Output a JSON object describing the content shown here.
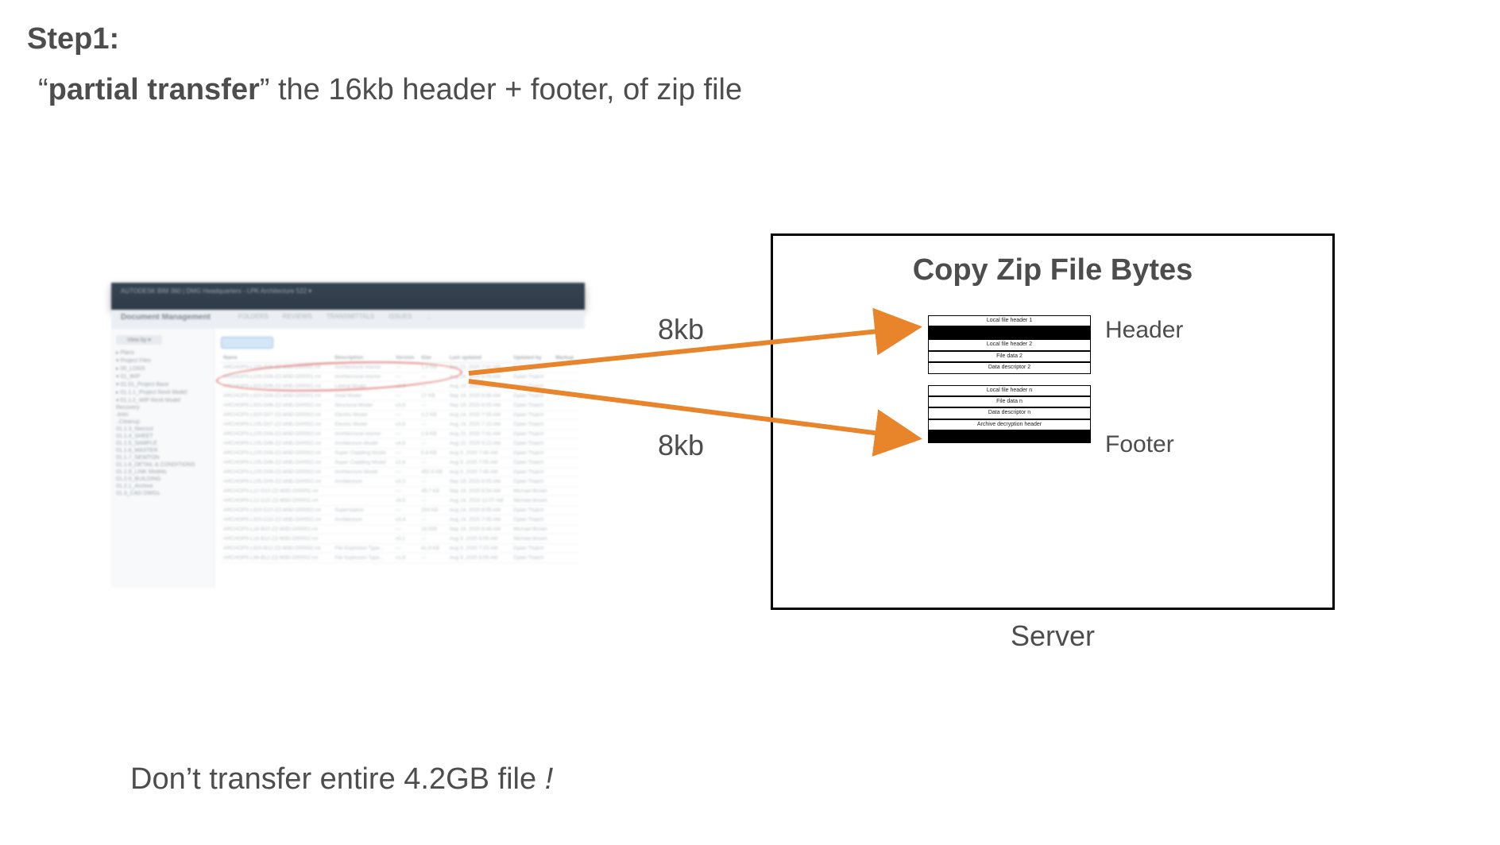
{
  "step": {
    "label": "Step1:",
    "quote_open": "“",
    "bold_phrase": "partial transfer",
    "quote_close": "”",
    "rest": " the 16kb header + footer, of zip file"
  },
  "arrows": {
    "top_label": "8kb",
    "bottom_label": "8kb"
  },
  "server": {
    "title": "Copy Zip File Bytes",
    "caption": "Server",
    "header_label": "Header",
    "footer_label": "Footer",
    "zip_rows": {
      "r1": "Local file header 1",
      "r3": "Local file header 2",
      "r4": "File data 2",
      "r5": "Data descriptor 2",
      "r6": "Local file header n",
      "r7": "File data n",
      "r8": "Data descriptor n",
      "r9": "Archive decryption header"
    }
  },
  "footer_note": {
    "text": "Don’t transfer entire 4.2GB file ",
    "excl": "!"
  },
  "client_shot": {
    "topbar": "AUTODESK  BIM 360   |  DMG Headquarters - LPK Architecture 522 ▾",
    "title": "Document Management",
    "tabs": [
      "FOLDERS",
      "REVIEWS",
      "TRANSMITTALS",
      "ISSUES",
      "..."
    ],
    "sidebar_btn": "View by ▾",
    "sidebar_items": [
      "▸ Plans",
      "  ▾ Project Files",
      "    ▸ 00_LOGS",
      "    ▾ 01_WIP",
      "      ▾ 01.01_Project Base",
      "        ▸ 01.1.1_Project Revit Model",
      "        ▾ 01.1.2_WIP Revit Model",
      "          Recovery",
      "          .links",
      "          ..Cleanup",
      "          01.1.3_Nwcout",
      "          01.1.4_SHEET",
      "          01.1.5_SAMPLE",
      "          01.1.6_MASTER",
      "          01.1.7_NEWTON",
      "          01.1.8_DETAIL & CONDITIONS",
      "          01.1.9_LINK Models",
      "          01.2.0_BUILDING",
      "          01.2.1_Archive",
      "          01.3_CAD DWGs"
    ],
    "columns": [
      "Name",
      "Description",
      "Version",
      "Size",
      "Last updated",
      "Updated by",
      "Markup"
    ],
    "rows": [
      [
        "ARCHOPS-L105-P06-ZZ-M3D-D00001.rvt",
        "Architectural Interior",
        "—",
        "1.1 GB",
        "Sep 21, 2020 7:41 AM",
        "Dylan Thatch",
        ""
      ],
      [
        "ARCHOPS-L105-D06-ZZ-M3D-D00001.rvt",
        "Architectural Interior",
        "—",
        "—",
        "Aug 24, 2020 8:05 AM",
        "Dylan Thatch",
        ""
      ],
      [
        "ARCHOPS-L920-D06-ZZ-M3D-D00001.rvt",
        "Lateral Model",
        "v3.6",
        "—",
        "Aug 24, 2020 8:05 AM",
        "Dylan Thatch",
        ""
      ],
      [
        "ARCHOPS-L920-D06-ZZ-M3D-D00001.rvt",
        "Axial Model",
        "—",
        "17 KB",
        "Sep 19, 2020 8:55 AM",
        "Dylan Thatch",
        ""
      ],
      [
        "ARCHOPS-L920-D06-ZZ-M3D-D00002.rvt",
        "Structural Model",
        "v3.6",
        "—",
        "Sep 19, 2020 8:05 AM",
        "Dylan Thatch",
        ""
      ],
      [
        "ARCHOPS-L920-D07-ZZ-M3D-D00002.rvt",
        "Electric Model",
        "—",
        "3.2 KB",
        "Aug 24, 2020 7:05 AM",
        "Dylan Thatch",
        ""
      ],
      [
        "ARCHOPS-L105-D07-ZZ-M3D-D00002.rvt",
        "Electric Model",
        "v3.8",
        "—",
        "Aug 24, 2020 7:23 AM",
        "Dylan Thatch",
        ""
      ],
      [
        "ARCHOPS-L105-D08-ZZ-M3D-D00002.rvt",
        "Architectural Interior",
        "—",
        "2.8 KB",
        "Aug 22, 2020 7:41 AM",
        "Dylan Thatch",
        ""
      ],
      [
        "ARCHOPS-L105-D08-ZZ-M3D-D00002.rvt",
        "Architecture Model",
        "v4.8",
        "—",
        "Aug 22, 2020 9:23 AM",
        "Dylan Thatch",
        ""
      ],
      [
        "ARCHOPS-L105-D08-ZZ-M3D-D00002.rvt",
        "Super Cladding Model",
        "—",
        "5.8 KB",
        "Aug 9, 2020 7:46 AM",
        "Dylan Thatch",
        ""
      ],
      [
        "ARCHOPS-L105-D08-ZZ-M3D-D00002.rvt",
        "Super Cladding Model",
        "v2.8",
        "—",
        "Aug 9, 2020 7:05 AM",
        "Dylan Thatch",
        ""
      ],
      [
        "ARCHOPS-L105-D09-ZZ-M3D-D00002.rvt",
        "Architecture Model",
        "—",
        "492.8 KB",
        "Aug 9, 2020 7:46 AM",
        "Dylan Thatch",
        ""
      ],
      [
        "ARCHOPS-L105-D09-ZZ-M3D-D00002.rvt",
        "Architecture",
        "v3.3",
        "—",
        "Sep 19, 2020 8:05 AM",
        "Dylan Thatch",
        ""
      ],
      [
        "ARCHOPS-L12-D10-ZZ-M3D-D00002.rvt",
        "",
        "—",
        "49.7 KB",
        "Sep 19, 2020 8:54 AM",
        "Michael Brown",
        ""
      ],
      [
        "ARCHOPS-L12-D10-ZZ-M3D-D00002.rvt",
        "",
        "v9.5",
        "—",
        "Aug 24, 2020 12:07 AM",
        "Michael Brown",
        ""
      ],
      [
        "ARCHOPS-L920-D10-ZZ-M3D-D00002.rvt",
        "Superstation",
        "—",
        "204 KB",
        "Aug 24, 2020 8:05 AM",
        "Dylan Thatch",
        ""
      ],
      [
        "ARCHOPS-L920-D10-ZZ-M3D-D00002.rvt",
        "Architecture",
        "v3.4",
        "—",
        "Aug 24, 2020 7:05 AM",
        "Dylan Thatch",
        ""
      ],
      [
        "ARCHOPS-L18-B10-ZZ-M3D-D00002.rvt",
        "",
        "—",
        "16.939",
        "Sep 19, 2020 6:46 AM",
        "Michael Brown",
        ""
      ],
      [
        "ARCHOPS-L18-B10-ZZ-M3D-D00002.rvt",
        "",
        "v5.1",
        "—",
        "Aug 9, 2020 8:05 AM",
        "Michael Brown",
        ""
      ],
      [
        "ARCHOPS-L920-B12-ZZ-M3D-D00002.rvt",
        "File Explosion Type...",
        "—",
        "41.8 KB",
        "Aug 9, 2020 7:23 AM",
        "Dylan Thatch",
        ""
      ],
      [
        "ARCHOPS-L98-B12-ZZ-M3D-D00002.rvt",
        "File Explosion Type...",
        "v1.8",
        "—",
        "Aug 9, 2020 8:05 AM",
        "Dylan Thatch",
        ""
      ]
    ]
  }
}
